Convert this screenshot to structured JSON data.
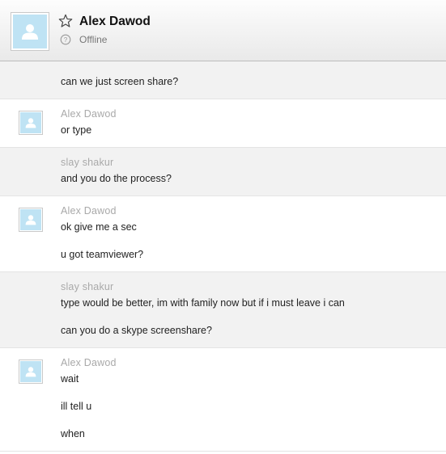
{
  "contact": {
    "name": "Alex Dawod",
    "status": "Offline",
    "avatar_icon": "user-silhouette-icon",
    "favorite_icon": "star-outline-icon",
    "status_icon": "offline-status-icon"
  },
  "messages": [
    {
      "sender": "",
      "lines": [
        "can we just screen share?"
      ]
    },
    {
      "sender": "Alex Dawod",
      "lines": [
        "or type"
      ]
    },
    {
      "sender": "slay shakur",
      "lines": [
        "and you do the process?"
      ]
    },
    {
      "sender": "Alex Dawod",
      "lines": [
        "ok give me  a sec",
        "u got teamviewer?"
      ]
    },
    {
      "sender": "slay shakur",
      "lines": [
        "type would be better, im with family now but if i must leave i can",
        "can you do a skype screenshare?"
      ]
    },
    {
      "sender": "Alex Dawod",
      "lines": [
        "wait",
        "ill tell u",
        "when"
      ]
    }
  ],
  "colors": {
    "avatar_bg": "#bfe3f4",
    "grey_row": "#f2f2f2",
    "sender_text": "#a9a9a9"
  }
}
